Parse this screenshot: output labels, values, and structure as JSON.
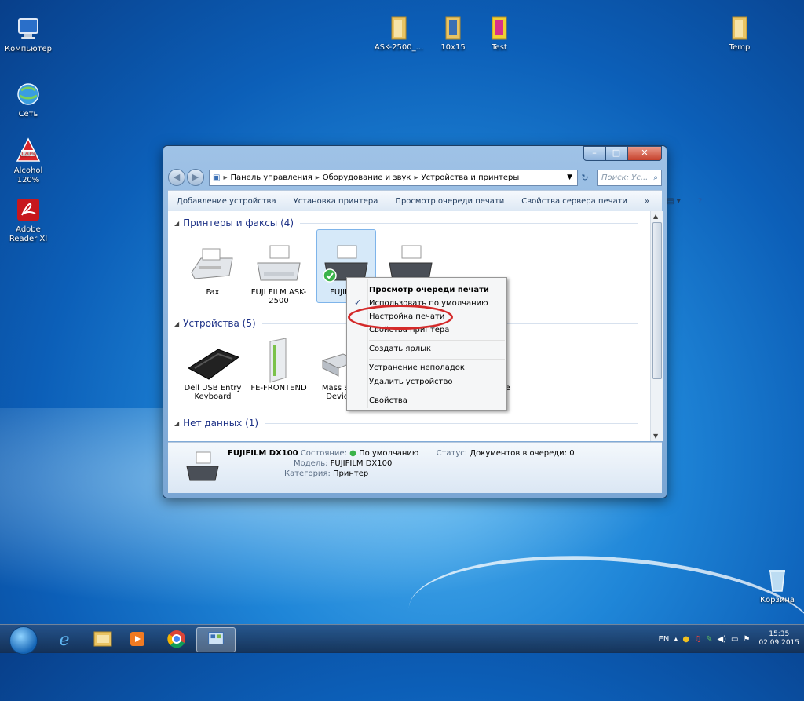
{
  "desktop": {
    "icons": [
      {
        "label": "Компьютер"
      },
      {
        "label": "Сеть"
      },
      {
        "label": "Alcohol 120%"
      },
      {
        "label": "Adobe Reader XI"
      },
      {
        "label": "ASK-2500_..."
      },
      {
        "label": "10x15"
      },
      {
        "label": "Test"
      },
      {
        "label": "Temp"
      },
      {
        "label": "Корзина"
      }
    ]
  },
  "window": {
    "breadcrumb": [
      "Панель управления",
      "Оборудование и звук",
      "Устройства и принтеры"
    ],
    "search_placeholder": "Поиск: Ус...",
    "toolbar": {
      "items": [
        "Добавление устройства",
        "Установка принтера",
        "Просмотр очереди печати",
        "Свойства сервера печати",
        "»"
      ]
    },
    "groups": [
      {
        "title": "Принтеры и факсы (4)"
      },
      {
        "title": "Устройства (5)"
      },
      {
        "title": "Нет данных (1)"
      }
    ],
    "printers": [
      {
        "label": "Fax"
      },
      {
        "label": "FUJI FILM ASK-2500"
      },
      {
        "label": "FUJIFILM"
      },
      {
        "label": ""
      }
    ],
    "devices": [
      {
        "label": "Dell USB Entry Keyboard"
      },
      {
        "label": "FE-FRONTEND"
      },
      {
        "label": "Mass St... Devic..."
      },
      {
        "label": "mouse"
      }
    ],
    "details": {
      "name": "FUJIFILM DX100",
      "state_label": "Состояние:",
      "state_value": "По умолчанию",
      "status_label": "Статус:",
      "status_value": "Документов в очереди: 0",
      "model_label": "Модель:",
      "model_value": "FUJIFILM DX100",
      "category_label": "Категория:",
      "category_value": "Принтер"
    }
  },
  "context_menu": {
    "items": [
      {
        "label": "Просмотр очереди печати",
        "bold": true
      },
      {
        "label": "Использовать по умолчанию",
        "checked": true
      },
      {
        "label": "Настройка печати",
        "circled": true
      },
      {
        "label": "Свойства принтера"
      },
      {
        "label": "Создать ярлык"
      },
      {
        "label": "Устранение неполадок"
      },
      {
        "label": "Удалить устройство"
      },
      {
        "label": "Свойства"
      }
    ]
  },
  "taskbar": {
    "lang": "EN",
    "time": "15:35",
    "date": "02.09.2015"
  },
  "colors": {
    "highlight_ring": "#d42a2a",
    "group_header": "#1e3287"
  }
}
